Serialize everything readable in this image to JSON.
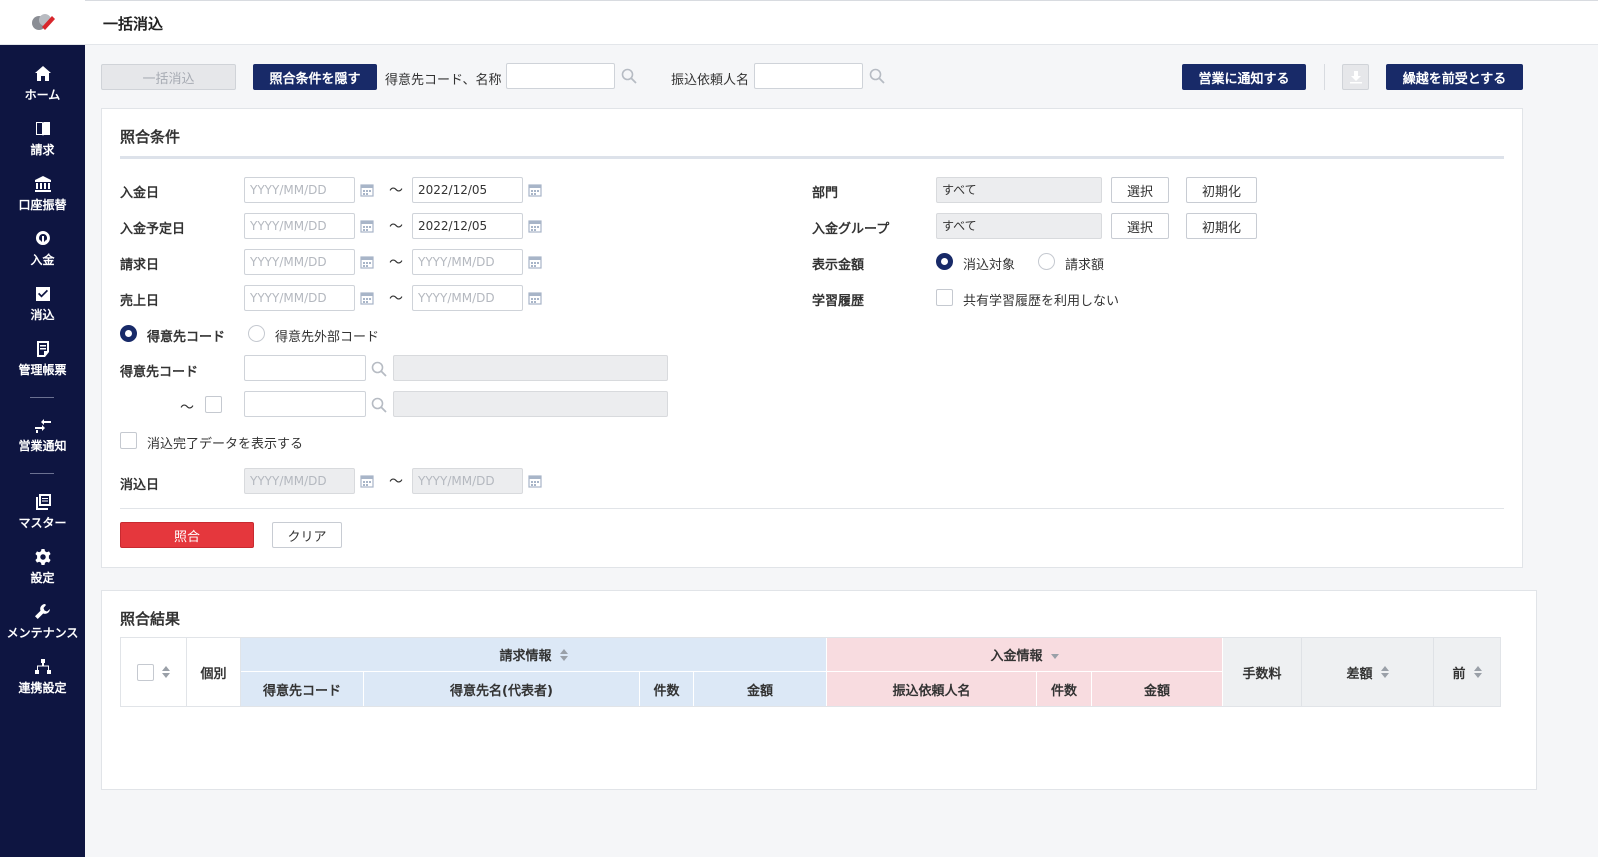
{
  "header": {
    "title": "一括消込"
  },
  "sidebar": {
    "items": [
      {
        "label": "ホーム",
        "icon": "home-icon"
      },
      {
        "label": "請求",
        "icon": "book-icon"
      },
      {
        "label": "口座振替",
        "icon": "bank-icon"
      },
      {
        "label": "入金",
        "icon": "deposit-icon"
      },
      {
        "label": "消込",
        "icon": "check-square-icon"
      },
      {
        "label": "管理帳票",
        "icon": "report-icon"
      },
      {
        "label": "営業通知",
        "icon": "arrows-icon"
      },
      {
        "label": "マスター",
        "icon": "stack-icon"
      },
      {
        "label": "設定",
        "icon": "gear-icon"
      },
      {
        "label": "メンテナンス",
        "icon": "wrench-icon"
      },
      {
        "label": "連携設定",
        "icon": "network-icon"
      }
    ]
  },
  "toolbar": {
    "bulk_label": "一括消込",
    "toggle_label": "照合条件を隠す",
    "customer_label": "得意先コード、名称",
    "customer_value": "",
    "payer_label": "振込依頼人名",
    "payer_value": "",
    "notify_label": "営業に通知する",
    "carryover_label": "繰越を前受とする"
  },
  "conditions": {
    "title": "照合条件",
    "placeholder": "YYYY/MM/DD",
    "tilde": "～",
    "deposit_date": {
      "label": "入金日",
      "from": "",
      "to": "2022/12/05"
    },
    "scheduled_date": {
      "label": "入金予定日",
      "from": "",
      "to": "2022/12/05"
    },
    "billing_date": {
      "label": "請求日",
      "from": "",
      "to": ""
    },
    "sales_date": {
      "label": "売上日",
      "from": "",
      "to": ""
    },
    "code_type": {
      "option1": "得意先コード",
      "option2": "得意先外部コード",
      "selected": "得意先コード"
    },
    "customer_code_label": "得意先コード",
    "show_completed_label": "消込完了データを表示する",
    "reconcile_date_label": "消込日",
    "department": {
      "label": "部門",
      "value": "すべて",
      "select_label": "選択",
      "reset_label": "初期化"
    },
    "deposit_group": {
      "label": "入金グループ",
      "value": "すべて",
      "select_label": "選択",
      "reset_label": "初期化"
    },
    "amount_display": {
      "label": "表示金額",
      "option1": "消込対象",
      "option2": "請求額",
      "selected": "消込対象"
    },
    "learning": {
      "label": "学習履歴",
      "checkbox_label": "共有学習履歴を利用しない"
    },
    "match_label": "照合",
    "clear_label": "クリア"
  },
  "results": {
    "title": "照合結果",
    "individual": "個別",
    "billing_group": "請求情報",
    "deposit_group": "入金情報",
    "fee": "手数料",
    "difference": "差額",
    "prev": "前",
    "billing_cols": [
      "得意先コード",
      "得意先名(代表者)",
      "件数",
      "金額"
    ],
    "deposit_cols": [
      "振込依頼人名",
      "件数",
      "金額"
    ]
  },
  "colors": {
    "navy": "#182a68",
    "sidebar": "#0e1541",
    "red": "#e5373d"
  }
}
